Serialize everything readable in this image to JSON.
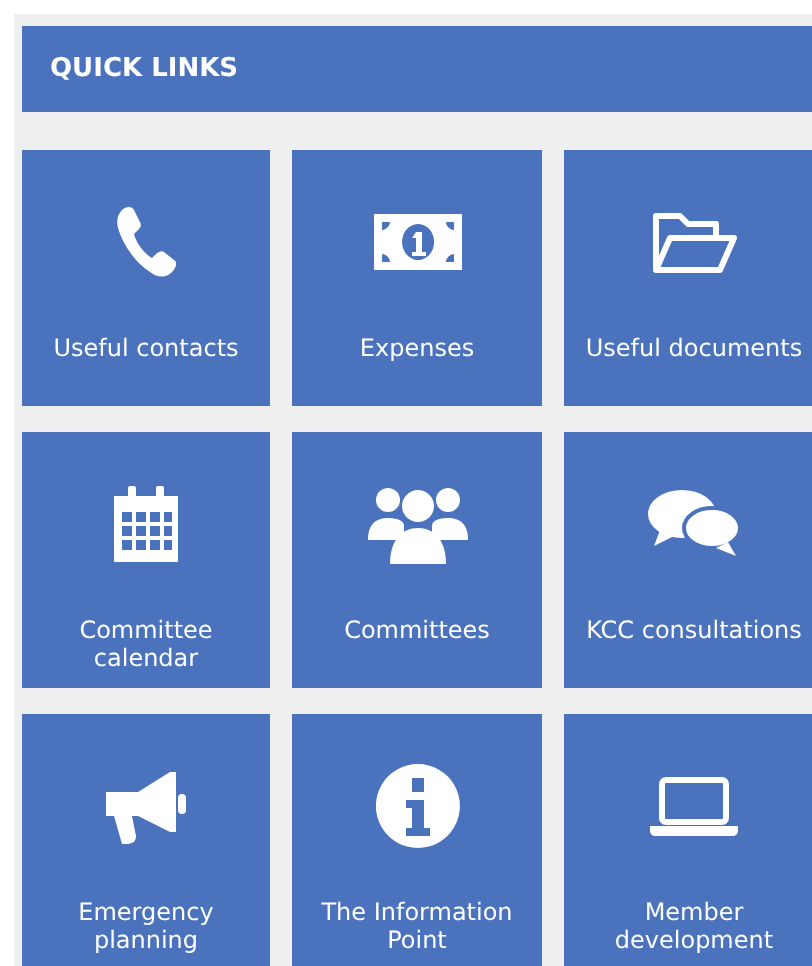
{
  "header": {
    "title": "QUICK LINKS"
  },
  "tiles": [
    {
      "label": "Useful contacts"
    },
    {
      "label": "Expenses"
    },
    {
      "label": "Useful documents"
    },
    {
      "label": "Committee calendar"
    },
    {
      "label": "Committees"
    },
    {
      "label": "KCC consultations"
    },
    {
      "label": "Emergency planning"
    },
    {
      "label": "The Information Point"
    },
    {
      "label": "Member development"
    }
  ]
}
